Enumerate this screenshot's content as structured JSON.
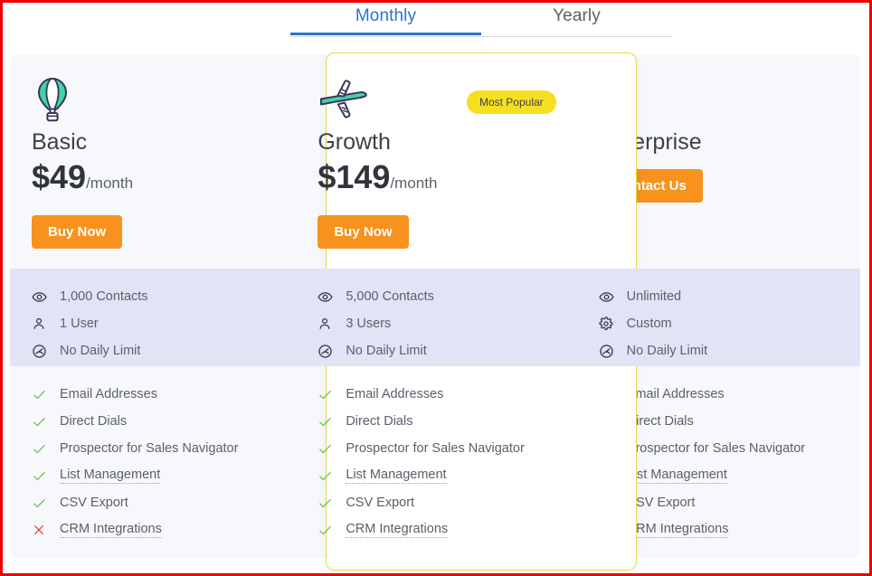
{
  "tabs": [
    {
      "label": "Monthly",
      "active": true
    },
    {
      "label": "Yearly",
      "active": false
    }
  ],
  "colors": {
    "accent_blue": "#2a73cc",
    "cta_orange": "#f7921e",
    "badge_yellow": "#f6df20",
    "featured_border": "#e6d84a",
    "stats_band": "#e2e4f6",
    "panel_bg": "#f7f8fb",
    "check_green": "#6fbf4f",
    "cross_red": "#e8413a"
  },
  "plans": [
    {
      "id": "basic",
      "icon": "hot-air-balloon-icon",
      "name": "Basic",
      "price": "$49",
      "period": "/month",
      "cta_label": "Buy Now",
      "featured": false,
      "badge": null,
      "stats": [
        {
          "icon": "eye-icon",
          "label": "1,000 Contacts"
        },
        {
          "icon": "user-icon",
          "label": "1 User"
        },
        {
          "icon": "gauge-icon",
          "label": "No Daily Limit"
        }
      ],
      "features": [
        {
          "label": "Email Addresses",
          "included": true,
          "hinted": false
        },
        {
          "label": "Direct Dials",
          "included": true,
          "hinted": false
        },
        {
          "label": "Prospector for Sales Navigator",
          "included": true,
          "hinted": false
        },
        {
          "label": "List Management",
          "included": true,
          "hinted": true
        },
        {
          "label": "CSV Export",
          "included": true,
          "hinted": false
        },
        {
          "label": "CRM Integrations",
          "included": false,
          "hinted": true
        }
      ]
    },
    {
      "id": "growth",
      "icon": "airplane-icon",
      "name": "Growth",
      "price": "$149",
      "period": "/month",
      "cta_label": "Buy Now",
      "featured": true,
      "badge": "Most Popular",
      "stats": [
        {
          "icon": "eye-icon",
          "label": "5,000 Contacts"
        },
        {
          "icon": "user-icon",
          "label": "3 Users"
        },
        {
          "icon": "gauge-icon",
          "label": "No Daily Limit"
        }
      ],
      "features": [
        {
          "label": "Email Addresses",
          "included": true,
          "hinted": false
        },
        {
          "label": "Direct Dials",
          "included": true,
          "hinted": false
        },
        {
          "label": "Prospector for Sales Navigator",
          "included": true,
          "hinted": false
        },
        {
          "label": "List Management",
          "included": true,
          "hinted": true
        },
        {
          "label": "CSV Export",
          "included": true,
          "hinted": false
        },
        {
          "label": "CRM Integrations",
          "included": true,
          "hinted": true
        }
      ]
    },
    {
      "id": "enterprise",
      "icon": "rocket-icon",
      "name": "Enterprise",
      "price": "",
      "period": "",
      "cta_label": "Contact Us",
      "featured": false,
      "badge": null,
      "stats": [
        {
          "icon": "eye-icon",
          "label": "Unlimited"
        },
        {
          "icon": "gear-icon",
          "label": "Custom"
        },
        {
          "icon": "gauge-icon",
          "label": "No Daily Limit"
        }
      ],
      "features": [
        {
          "label": "Email Addresses",
          "included": true,
          "hinted": false
        },
        {
          "label": "Direct Dials",
          "included": true,
          "hinted": false
        },
        {
          "label": "Prospector for Sales Navigator",
          "included": true,
          "hinted": false
        },
        {
          "label": "List Management",
          "included": true,
          "hinted": true
        },
        {
          "label": "CSV Export",
          "included": true,
          "hinted": false
        },
        {
          "label": "CRM Integrations",
          "included": true,
          "hinted": true
        }
      ]
    }
  ]
}
